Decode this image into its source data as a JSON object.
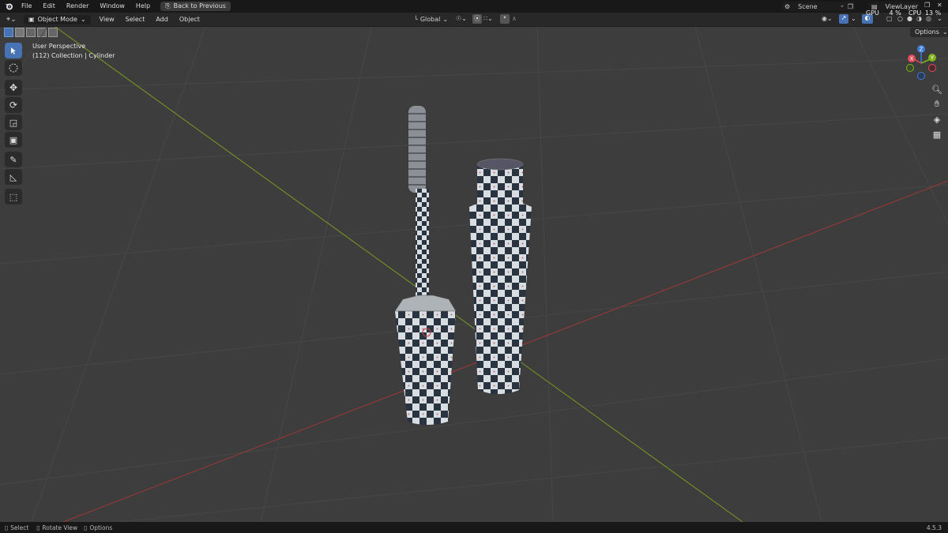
{
  "topbar": {
    "menus": [
      "File",
      "Edit",
      "Render",
      "Window",
      "Help"
    ],
    "back_button": "Back to Previous",
    "scene_label": "Scene",
    "view_layer_label": "ViewLayer",
    "gpu_label": "GPU",
    "gpu_value": "4 %",
    "cpu_label": "CPU",
    "cpu_value": "13 %"
  },
  "header": {
    "mode": "Object Mode",
    "menus": [
      "View",
      "Select",
      "Add",
      "Object"
    ],
    "orientation": "Global",
    "options_label": "Options"
  },
  "viewport": {
    "perspective": "User Perspective",
    "collection_info": "(112) Collection | Cylinder"
  },
  "gizmo": {
    "x_label": "X",
    "y_label": "Y",
    "z_label": "Z",
    "x_color": "#e04a5a",
    "y_color": "#7fb31a",
    "z_color": "#3e7bd6"
  },
  "statusbar": {
    "select": "Select",
    "rotate": "Rotate View",
    "options": "Options",
    "version": "4.5.3"
  },
  "tools": [
    "select-box",
    "cursor",
    "move",
    "rotate",
    "scale",
    "transform",
    "annotate",
    "measure",
    "add-cube"
  ],
  "colors": {
    "accent": "#4772b3",
    "x_axis_line": "#a03838",
    "y_axis_line": "#7a9a22",
    "viewport_bg": "#3d3d3d"
  }
}
